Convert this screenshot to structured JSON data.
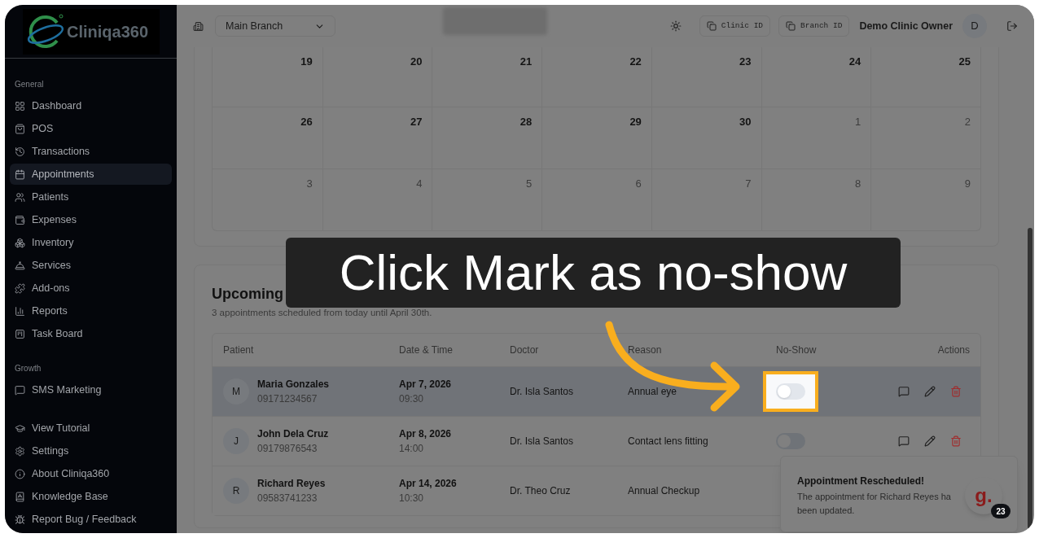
{
  "sidebar": {
    "logo_text": "Cliniqa360",
    "sections": [
      {
        "label": "General",
        "items": [
          {
            "label": "Dashboard",
            "selected": false
          },
          {
            "label": "POS",
            "selected": false
          },
          {
            "label": "Transactions",
            "selected": false
          },
          {
            "label": "Appointments",
            "selected": true
          },
          {
            "label": "Patients",
            "selected": false
          },
          {
            "label": "Expenses",
            "selected": false
          },
          {
            "label": "Inventory",
            "selected": false
          },
          {
            "label": "Services",
            "selected": false
          },
          {
            "label": "Add-ons",
            "selected": false
          },
          {
            "label": "Reports",
            "selected": false
          },
          {
            "label": "Task Board",
            "selected": false
          }
        ]
      },
      {
        "label": "Growth",
        "items": [
          {
            "label": "SMS Marketing",
            "selected": false
          }
        ]
      }
    ],
    "footer_items": [
      {
        "label": "View Tutorial"
      },
      {
        "label": "Settings"
      },
      {
        "label": "About Cliniqa360"
      },
      {
        "label": "Knowledge Base"
      },
      {
        "label": "Report Bug / Feedback"
      }
    ]
  },
  "topbar": {
    "branch_select": "Main Branch",
    "clinic_id_button": "Clinic ID",
    "branch_id_button": "Branch ID",
    "user_name": "Demo Clinic Owner",
    "avatar": "D"
  },
  "calendar": {
    "weeks": [
      [
        {
          "day": "19",
          "current": true
        },
        {
          "day": "20",
          "current": true
        },
        {
          "day": "21",
          "current": true
        },
        {
          "day": "22",
          "current": true
        },
        {
          "day": "23",
          "current": true
        },
        {
          "day": "24",
          "current": true
        },
        {
          "day": "25",
          "current": true
        }
      ],
      [
        {
          "day": "26",
          "current": true
        },
        {
          "day": "27",
          "current": true
        },
        {
          "day": "28",
          "current": true
        },
        {
          "day": "29",
          "current": true
        },
        {
          "day": "30",
          "current": true
        },
        {
          "day": "1",
          "current": false
        },
        {
          "day": "2",
          "current": false
        }
      ],
      [
        {
          "day": "3",
          "current": false
        },
        {
          "day": "4",
          "current": false
        },
        {
          "day": "5",
          "current": false
        },
        {
          "day": "6",
          "current": false
        },
        {
          "day": "7",
          "current": false
        },
        {
          "day": "8",
          "current": false
        },
        {
          "day": "9",
          "current": false
        }
      ]
    ]
  },
  "upcoming": {
    "title": "Upcoming",
    "subtitle": "3 appointments scheduled from today until April 30th.",
    "columns": [
      "Patient",
      "Date & Time",
      "Doctor",
      "Reason",
      "No-Show",
      "Actions"
    ],
    "rows": [
      {
        "initial": "M",
        "name": "Maria Gonzales",
        "phone": "09171234567",
        "date": "Apr 7, 2026",
        "time": "09:30",
        "doctor": "Dr. Isla Santos",
        "reason": "Annual eye",
        "no_show": {
          "on": false,
          "highlighted": true
        },
        "selected": true
      },
      {
        "initial": "J",
        "name": "John Dela Cruz",
        "phone": "09179876543",
        "date": "Apr 8, 2026",
        "time": "14:00",
        "doctor": "Dr. Isla Santos",
        "reason": "Contact lens fitting",
        "no_show": {
          "on": false,
          "highlighted": false
        },
        "selected": false
      },
      {
        "initial": "R",
        "name": "Richard Reyes",
        "phone": "09583741233",
        "date": "Apr 14, 2026",
        "time": "10:30",
        "doctor": "Dr. Theo Cruz",
        "reason": "Annual Checkup",
        "selected": false
      }
    ]
  },
  "tutorial_tooltip": "Click Mark as no-show",
  "toast": {
    "title": "Appointment Rescheduled!",
    "lines": [
      "The appointment for Richard Reyes ha",
      "been updated."
    ]
  },
  "help_badge": {
    "letter": "g.",
    "count": "23"
  }
}
